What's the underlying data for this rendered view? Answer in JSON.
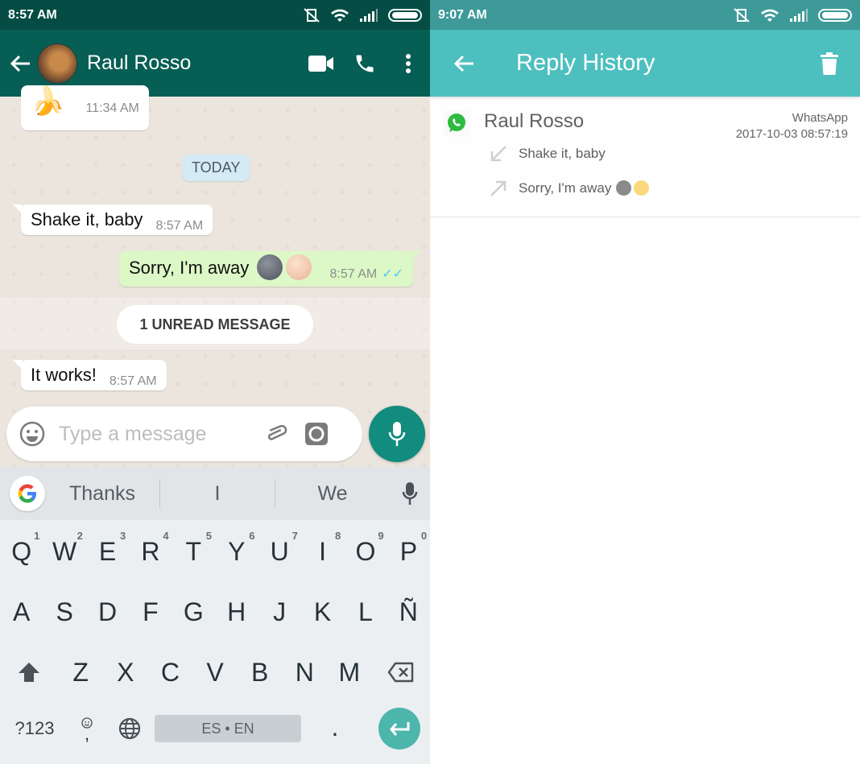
{
  "left": {
    "status_bar": {
      "time": "8:57 AM"
    },
    "header": {
      "contact_name": "Raul Rosso"
    },
    "chat": {
      "earlier_message": {
        "emoji": "🍌",
        "time": "11:34 AM"
      },
      "date_chip": "TODAY",
      "messages": [
        {
          "direction": "incoming",
          "text": "Shake it, baby",
          "time": "8:57 AM"
        },
        {
          "direction": "outgoing",
          "text": "Sorry, I'm away",
          "emojis": [
            "new-moon-face",
            "full-moon-face"
          ],
          "time": "8:57 AM",
          "read": true
        },
        {
          "direction": "incoming",
          "text": "It works!",
          "time": "8:57 AM"
        }
      ],
      "unread_banner": "1 UNREAD MESSAGE"
    },
    "composer": {
      "placeholder": "Type a message"
    },
    "keyboard": {
      "suggestions": [
        "Thanks",
        "I",
        "We"
      ],
      "row1": [
        {
          "key": "Q",
          "hint": "1"
        },
        {
          "key": "W",
          "hint": "2"
        },
        {
          "key": "E",
          "hint": "3"
        },
        {
          "key": "R",
          "hint": "4"
        },
        {
          "key": "T",
          "hint": "5"
        },
        {
          "key": "Y",
          "hint": "6"
        },
        {
          "key": "U",
          "hint": "7"
        },
        {
          "key": "I",
          "hint": "8"
        },
        {
          "key": "O",
          "hint": "9"
        },
        {
          "key": "P",
          "hint": "0"
        }
      ],
      "row2": [
        "A",
        "S",
        "D",
        "F",
        "G",
        "H",
        "J",
        "K",
        "L",
        "Ñ"
      ],
      "row3": [
        "Z",
        "X",
        "C",
        "V",
        "B",
        "N",
        "M"
      ],
      "symbols_label": "?123",
      "comma_label": ",",
      "period_label": ".",
      "space_label": "ES • EN"
    }
  },
  "right": {
    "status_bar": {
      "time": "9:07 AM"
    },
    "header": {
      "title": "Reply History"
    },
    "history": [
      {
        "contact": "Raul Rosso",
        "app": "WhatsApp",
        "timestamp": "2017-10-03 08:57:19",
        "received": "Shake it, baby",
        "replied": "Sorry, I'm away"
      }
    ]
  },
  "colors": {
    "wa_header": "#075e54",
    "wa_status": "#054d44",
    "wa_fab": "#128c7e",
    "outgoing_bubble": "#dcf8c6",
    "rh_header": "#4ebfbf",
    "rh_status": "#3e9a98",
    "keyboard_accent": "#4db6ac"
  }
}
